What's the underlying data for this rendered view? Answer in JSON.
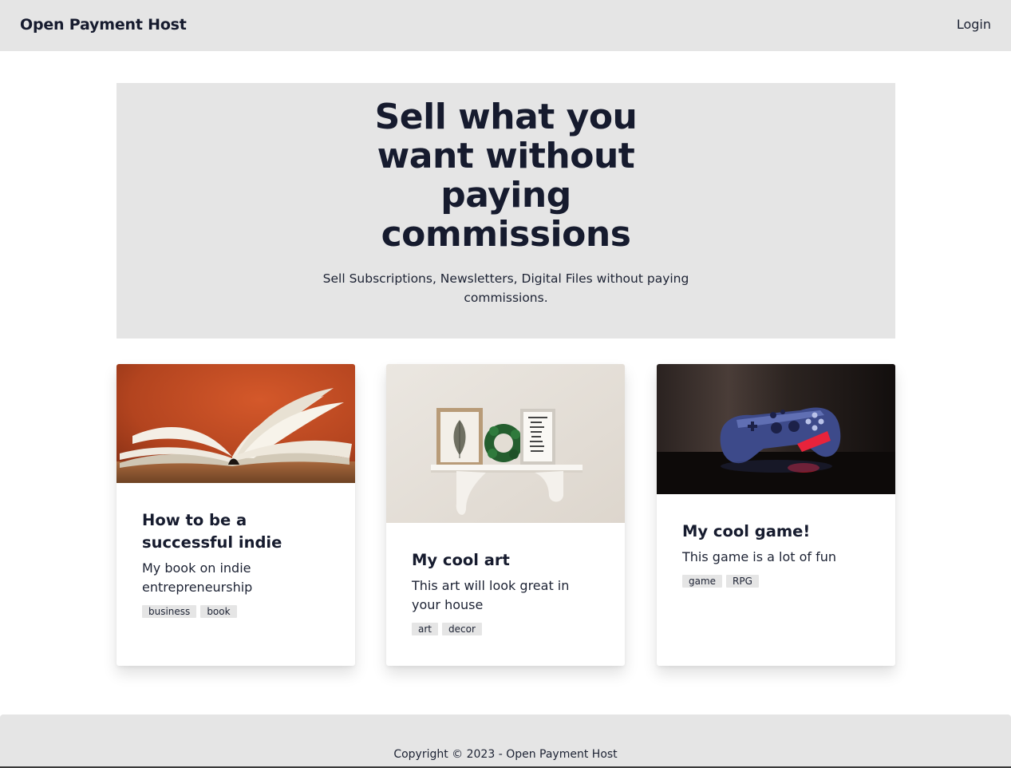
{
  "navbar": {
    "brand": "Open Payment Host",
    "login_label": "Login"
  },
  "hero": {
    "title": "Sell what you want without paying commissions",
    "subtitle": "Sell Subscriptions, Newsletters, Digital Files without paying commissions."
  },
  "products": [
    {
      "title": "How to be a successful indie",
      "description": "My book on indie entrepreneurship",
      "tags": [
        "business",
        "book"
      ],
      "image_icon": "open-book-photo"
    },
    {
      "title": "My cool art",
      "description": "This art will look great in your house",
      "tags": [
        "art",
        "decor"
      ],
      "image_icon": "wall-shelf-art-photo"
    },
    {
      "title": "My cool game!",
      "description": "This game is a lot of fun",
      "tags": [
        "game",
        "RPG"
      ],
      "image_icon": "game-controller-photo"
    }
  ],
  "footer": {
    "copyright": "Copyright © 2023 - Open Payment Host"
  },
  "colors": {
    "surface": "#e5e5e5",
    "text": "#161b2e",
    "background": "#ffffff"
  }
}
